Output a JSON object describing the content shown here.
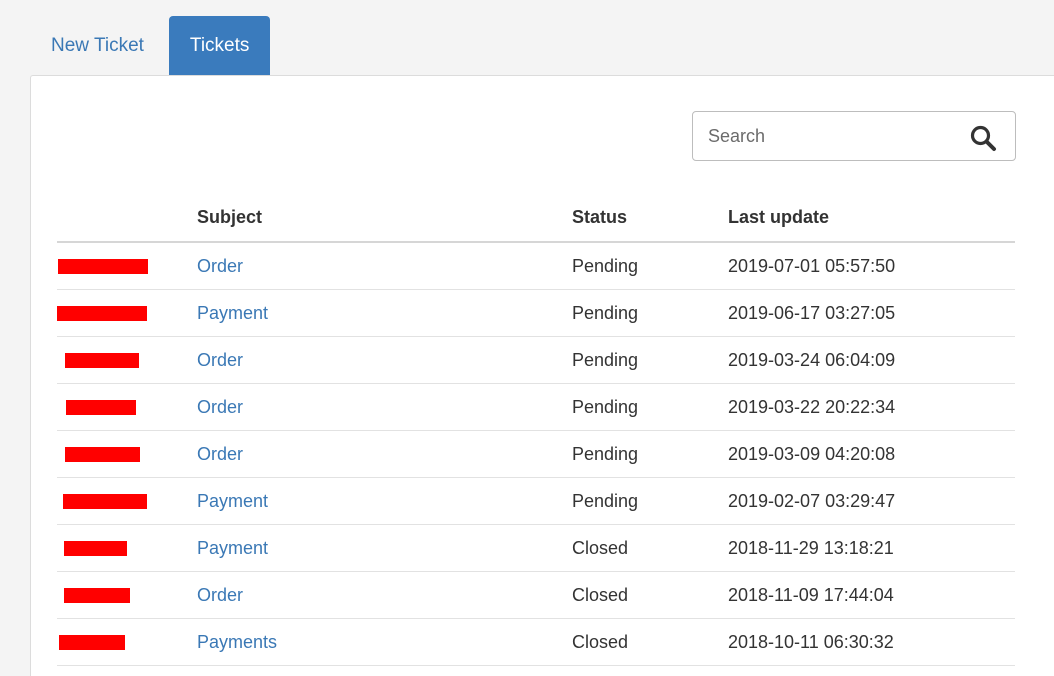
{
  "tabs": [
    {
      "label": "New Ticket",
      "active": false
    },
    {
      "label": "Tickets",
      "active": true
    }
  ],
  "search": {
    "placeholder": "Search"
  },
  "table": {
    "headers": {
      "id": "",
      "subject": "Subject",
      "status": "Status",
      "last_update": "Last update"
    },
    "rows": [
      {
        "subject": "Order",
        "status": "Pending",
        "last_update": "2019-07-01 05:57:50"
      },
      {
        "subject": "Payment",
        "status": "Pending",
        "last_update": "2019-06-17 03:27:05"
      },
      {
        "subject": "Order",
        "status": "Pending",
        "last_update": "2019-03-24 06:04:09"
      },
      {
        "subject": "Order",
        "status": "Pending",
        "last_update": "2019-03-22 20:22:34"
      },
      {
        "subject": "Order",
        "status": "Pending",
        "last_update": "2019-03-09 04:20:08"
      },
      {
        "subject": "Payment",
        "status": "Pending",
        "last_update": "2019-02-07 03:29:47"
      },
      {
        "subject": "Payment",
        "status": "Closed",
        "last_update": "2018-11-29 13:18:21"
      },
      {
        "subject": "Order",
        "status": "Closed",
        "last_update": "2018-11-09 17:44:04"
      },
      {
        "subject": "Payments",
        "status": "Closed",
        "last_update": "2018-10-11 06:30:32"
      }
    ]
  },
  "colors": {
    "link": "#3a78b5",
    "active_tab": "#3a7bbd",
    "redaction": "#ff0000"
  }
}
